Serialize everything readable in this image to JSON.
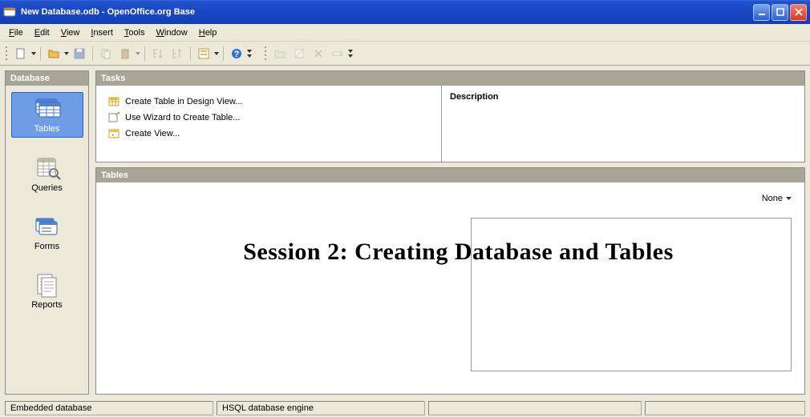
{
  "window": {
    "title": "New Database.odb - OpenOffice.org Base"
  },
  "menu": {
    "items": [
      "File",
      "Edit",
      "View",
      "Insert",
      "Tools",
      "Window",
      "Help"
    ]
  },
  "sidebar": {
    "title": "Database",
    "items": [
      {
        "label": "Tables",
        "selected": true
      },
      {
        "label": "Queries",
        "selected": false
      },
      {
        "label": "Forms",
        "selected": false
      },
      {
        "label": "Reports",
        "selected": false
      }
    ]
  },
  "tasksPanel": {
    "title": "Tasks",
    "items": [
      "Create Table in Design View...",
      "Use Wizard to Create Table...",
      "Create View..."
    ],
    "descriptionLabel": "Description"
  },
  "tablesPanel": {
    "title": "Tables",
    "viewMode": "None"
  },
  "overlay": {
    "text": "Session 2: Creating Database and Tables"
  },
  "statusbar": {
    "left": "Embedded database",
    "engine": "HSQL database engine"
  }
}
